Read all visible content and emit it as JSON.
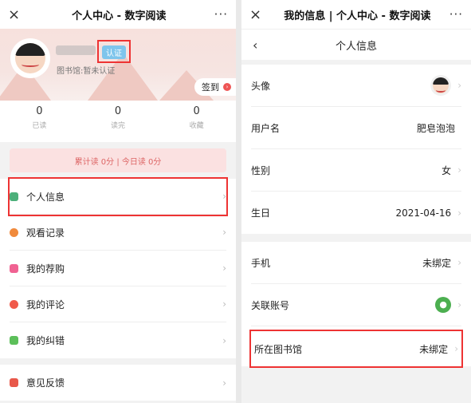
{
  "left": {
    "title": "个人中心 - 数字阅读",
    "badge": "认证",
    "library": "图书馆:暂未认证",
    "signin": "签到",
    "stats": [
      {
        "value": "0",
        "label": "已读"
      },
      {
        "value": "0",
        "label": "读完"
      },
      {
        "value": "0",
        "label": "收藏"
      }
    ],
    "reading_summary": "累计读 0分 | 今日读 0分",
    "menu": [
      {
        "label": "个人信息",
        "color": "#4caf7a"
      },
      {
        "label": "观看记录",
        "color": "#f08a3c"
      },
      {
        "label": "我的荐购",
        "color": "#f06292"
      },
      {
        "label": "我的评论",
        "color": "#f05a4a"
      },
      {
        "label": "我的纠错",
        "color": "#5cbf5a"
      }
    ],
    "feedback": {
      "label": "意见反馈",
      "color": "#e8584a"
    }
  },
  "right": {
    "title": "我的信息 | 个人中心 - 数字阅读",
    "nav_title": "个人信息",
    "rows": [
      {
        "label": "头像",
        "value": ""
      },
      {
        "label": "用户名",
        "value": "肥皂泡泡"
      },
      {
        "label": "性别",
        "value": "女"
      },
      {
        "label": "生日",
        "value": "2021-04-16"
      },
      {
        "label": "手机",
        "value": "未绑定"
      },
      {
        "label": "关联账号",
        "value": ""
      },
      {
        "label": "所在图书馆",
        "value": "未绑定"
      }
    ]
  },
  "icons": {
    "close": "×",
    "more": "···",
    "chevron": "›",
    "back": "‹"
  }
}
